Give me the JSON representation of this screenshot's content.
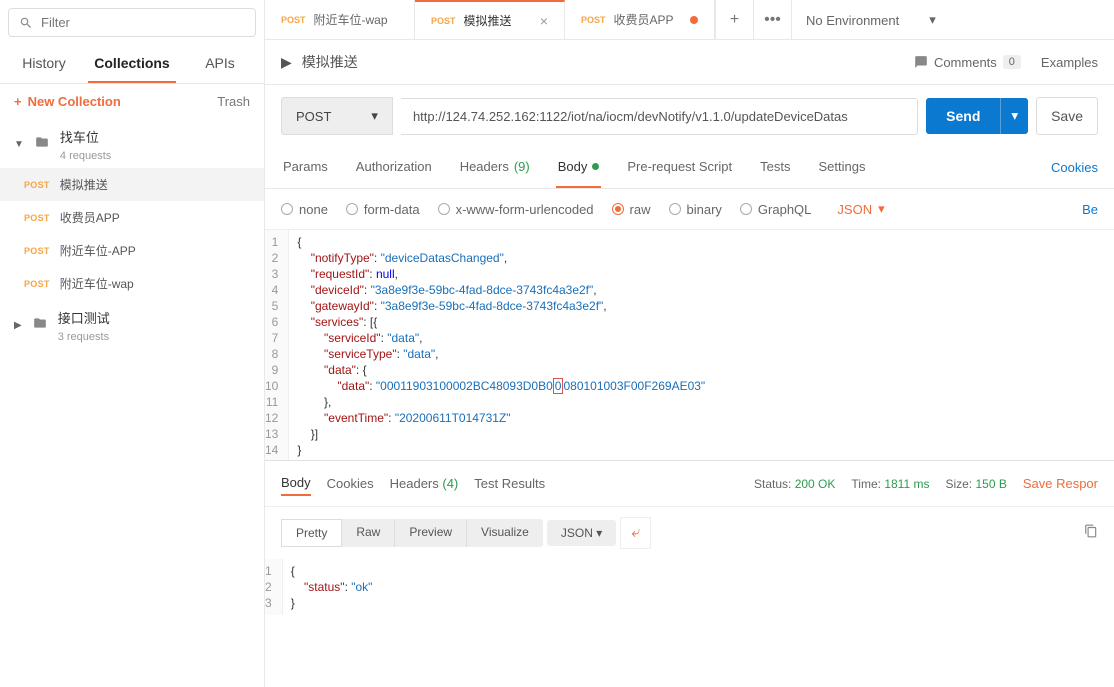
{
  "sidebar": {
    "filter_placeholder": "Filter",
    "tabs": {
      "history": "History",
      "collections": "Collections",
      "apis": "APIs"
    },
    "new_collection": "New Collection",
    "trash": "Trash",
    "folders": [
      {
        "name": "找车位",
        "meta": "4 requests"
      },
      {
        "name": "接口测试",
        "meta": "3 requests"
      }
    ],
    "requests": [
      {
        "method": "POST",
        "name": "模拟推送"
      },
      {
        "method": "POST",
        "name": "收费员APP"
      },
      {
        "method": "POST",
        "name": "附近车位-APP"
      },
      {
        "method": "POST",
        "name": "附近车位-wap"
      }
    ]
  },
  "tabs": [
    {
      "method": "POST",
      "name": "附近车位-wap",
      "mod": false
    },
    {
      "method": "POST",
      "name": "模拟推送",
      "mod": false,
      "active": true
    },
    {
      "method": "POST",
      "name": "收费员APP",
      "mod": true
    }
  ],
  "environment": {
    "none": "No Environment"
  },
  "title": "模拟推送",
  "comments_label": "Comments",
  "comments_count": "0",
  "examples_label": "Examples",
  "request": {
    "method": "POST",
    "url": "http://124.74.252.162:1122/iot/na/iocm/devNotify/v1.1.0/updateDeviceDatas",
    "send": "Send",
    "save": "Save"
  },
  "subtabs": {
    "params": "Params",
    "auth": "Authorization",
    "headers": "Headers",
    "headers_count": "(9)",
    "body": "Body",
    "prereq": "Pre-request Script",
    "tests": "Tests",
    "settings": "Settings",
    "cookies": "Cookies"
  },
  "body_types": {
    "none": "none",
    "formdata": "form-data",
    "xform": "x-www-form-urlencoded",
    "raw": "raw",
    "binary": "binary",
    "graphql": "GraphQL",
    "json": "JSON",
    "beautify": "Be"
  },
  "body_json": {
    "notifyType": "deviceDatasChanged",
    "requestId_key": "requestId",
    "requestId_val": "null",
    "deviceId": "3a8e9f3e-59bc-4fad-8dce-3743fc4a3e2f",
    "gatewayId": "3a8e9f3e-59bc-4fad-8dce-3743fc4a3e2f",
    "services_key": "services",
    "serviceId": "data",
    "serviceType": "data",
    "data_key": "data",
    "data_val_a": "00011903100002BC48093D0B0",
    "data_val_mark": "0",
    "data_val_b": "080101003F00F269AE03",
    "eventTime": "20200611T014731Z"
  },
  "response": {
    "tabs": {
      "body": "Body",
      "cookies": "Cookies",
      "headers": "Headers",
      "headers_count": "(4)",
      "tests": "Test Results"
    },
    "status_label": "Status:",
    "status_val": "200 OK",
    "time_label": "Time:",
    "time_val": "1811 ms",
    "size_label": "Size:",
    "size_val": "150 B",
    "save": "Save Respor",
    "view": {
      "pretty": "Pretty",
      "raw": "Raw",
      "preview": "Preview",
      "visualize": "Visualize",
      "json": "JSON"
    },
    "body": {
      "status_key": "status",
      "status_val": "ok"
    }
  }
}
